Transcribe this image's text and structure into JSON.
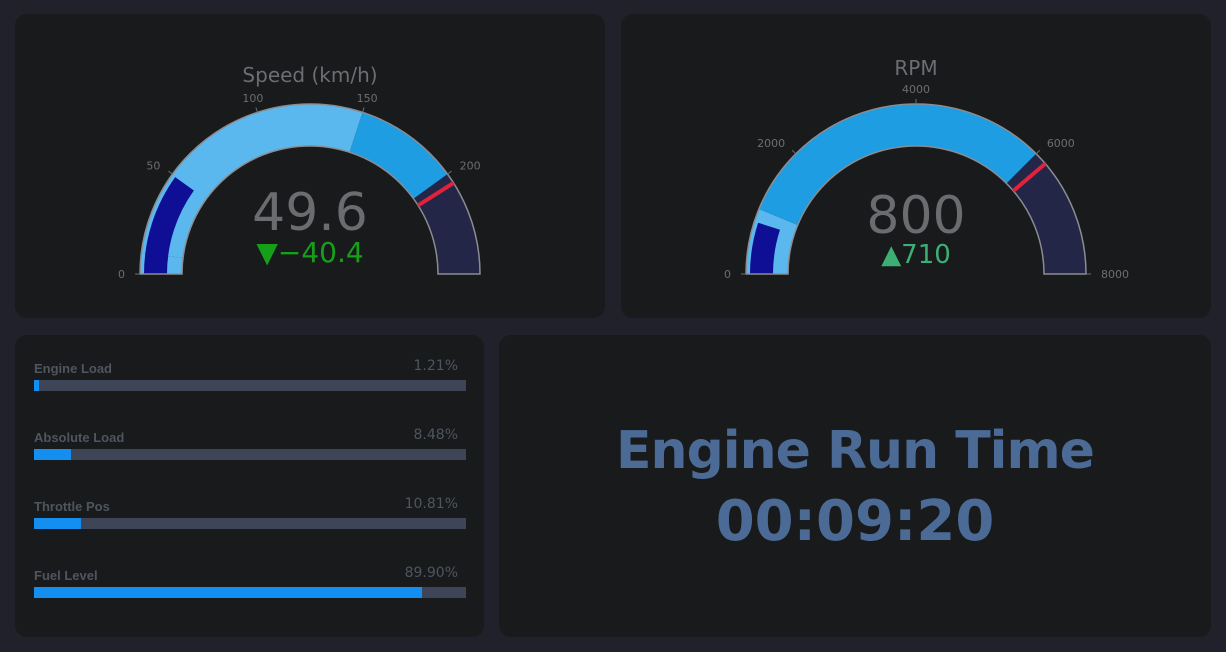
{
  "speed_gauge": {
    "title": "Speed (km/h)",
    "value": "49.6",
    "value_num": 49.6,
    "delta": "▼−40.4",
    "delta_color": "#16a019",
    "min": 0,
    "max": 250,
    "threshold": 205,
    "ticks": [
      "0",
      "50",
      "100",
      "150",
      "200"
    ],
    "tick_values": [
      0,
      50,
      100,
      150,
      200
    ],
    "steps": [
      {
        "from": 0,
        "to": 10,
        "color": "#5bb8ee"
      },
      {
        "from": 10,
        "to": 150,
        "color": "#5bb8ee"
      },
      {
        "from": 150,
        "to": 200,
        "color": "#1e9de3"
      },
      {
        "from": 200,
        "to": 250,
        "color": "#232647"
      }
    ],
    "bar_color": "#0f0f96"
  },
  "rpm_gauge": {
    "title": "RPM",
    "value": "800",
    "value_num": 800,
    "delta": "▲710",
    "delta_color": "#3dae74",
    "min": 0,
    "max": 8000,
    "threshold": 6200,
    "ticks": [
      "0",
      "2000",
      "4000",
      "6000",
      "8000"
    ],
    "tick_values": [
      0,
      2000,
      4000,
      6000,
      8000
    ],
    "steps": [
      {
        "from": 0,
        "to": 1000,
        "color": "#5bb8ee"
      },
      {
        "from": 1000,
        "to": 6000,
        "color": "#1e9de3"
      },
      {
        "from": 6000,
        "to": 8000,
        "color": "#232647"
      }
    ],
    "bar_color": "#0f0f96"
  },
  "load_bars": [
    {
      "label": "Engine Load",
      "value": "1.21%",
      "fraction": 0.0121
    },
    {
      "label": "Absolute Load",
      "value": "8.48%",
      "fraction": 0.0848
    },
    {
      "label": "Throttle Pos",
      "value": "10.81%",
      "fraction": 0.1081
    },
    {
      "label": "Fuel Level",
      "value": "89.90%",
      "fraction": 0.899
    }
  ],
  "run_time": {
    "title": "Engine Run Time",
    "value": "00:09:20"
  },
  "colors": {
    "background": "#20212a",
    "panel": "#181a1b",
    "bar_track": "#3d4556",
    "bar_fill": "#138ff1",
    "runtime_text": "#4b6b96",
    "threshold": "#e0233a"
  }
}
